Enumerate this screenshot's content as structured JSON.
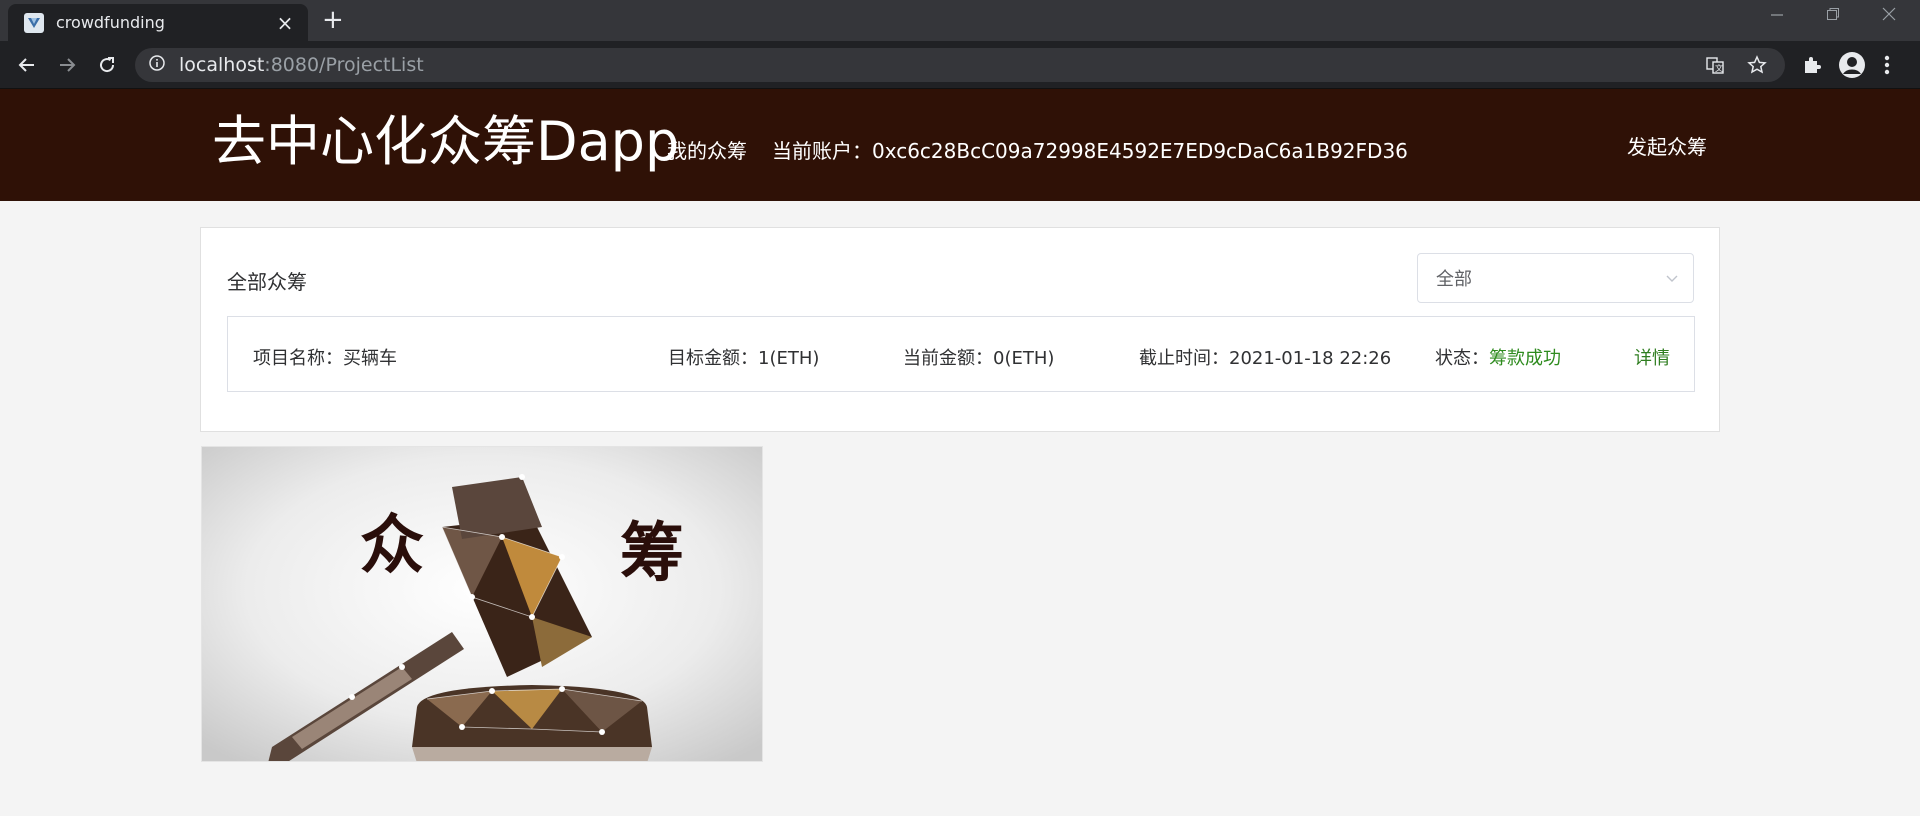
{
  "browser": {
    "tab_title": "crowdfunding",
    "url_host": "localhost",
    "url_rest": ":8080/ProjectList"
  },
  "header": {
    "site_title": "去中心化众筹Dapp",
    "nav_my": "我的众筹",
    "account_label": "当前账户：",
    "account_address": "0xc6c28BcC09a72998E4592E7ED9cDaC6a1B92FD36",
    "launch_button": "发起众筹"
  },
  "card": {
    "title": "全部众筹",
    "filter_value": "全部"
  },
  "project": {
    "name_label": "项目名称：",
    "name": "买辆车",
    "target_label": "目标金额：",
    "target": "1(ETH)",
    "current_label": "当前金额：",
    "current": "0(ETH)",
    "deadline_label": "截止时间：",
    "deadline": "2021-01-18 22:26",
    "status_label": "状态：",
    "status": "筹款成功",
    "detail_link": "详情"
  },
  "hero": {
    "left_char": "众",
    "right_char": "筹"
  },
  "colors": {
    "header_bg": "#2f1106",
    "status_green": "#2e8b1e"
  }
}
